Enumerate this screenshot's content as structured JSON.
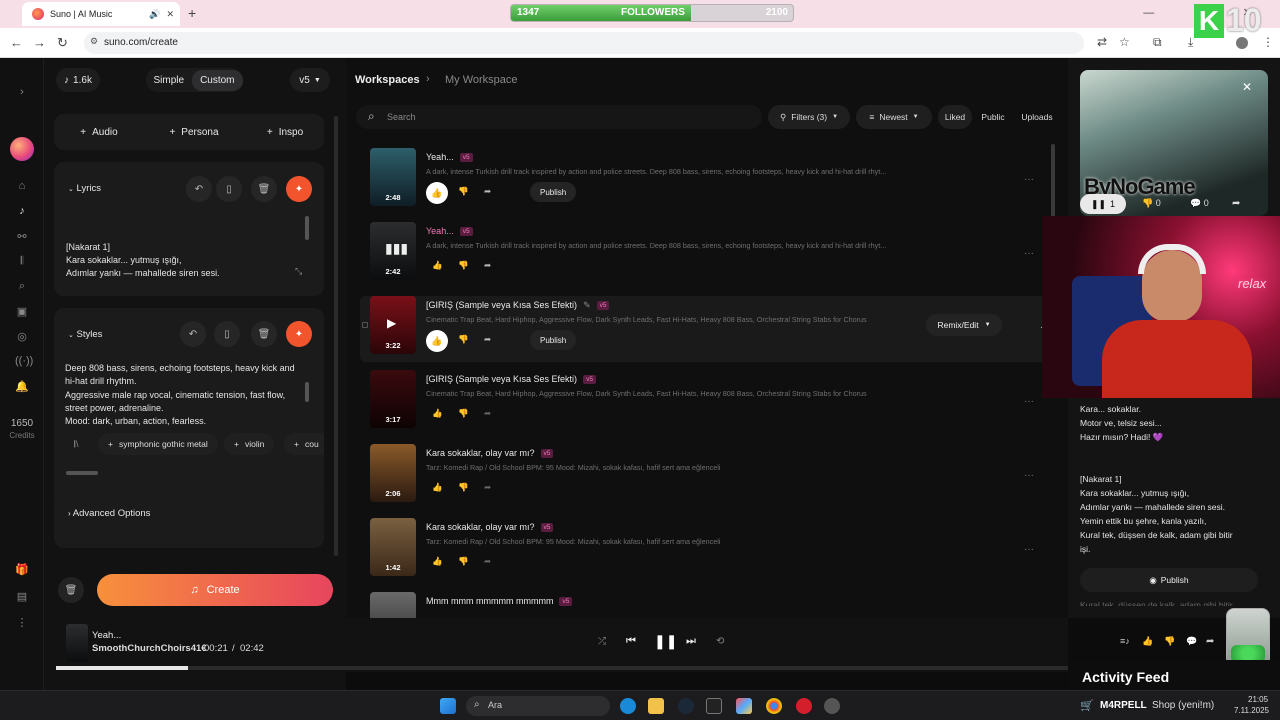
{
  "browser": {
    "tab_title": "Suno | AI Music",
    "new_tab": "+",
    "url": "suno.com/create",
    "window_controls": "—  ▢  ✕"
  },
  "overlay": {
    "followers_label": "FOLLOWERS",
    "followers_current": "1347",
    "followers_goal": "2100",
    "followers_progress": 0.64,
    "k_badge": "K",
    "k_number": "10",
    "watermark": "ByNoGame"
  },
  "sidebar": {
    "credits_value": "1650",
    "credits_label": "Credits"
  },
  "create": {
    "song_count": "1.6k",
    "mode_simple": "Simple",
    "mode_custom": "Custom",
    "model": "v5",
    "add_audio": "Audio",
    "add_persona": "Persona",
    "add_inspo": "Inspo",
    "lyrics_title": "Lyrics",
    "lyrics_lines": [
      "[Nakarat 1]",
      "Kara sokaklar... yutmuş ışığı,",
      "Adımlar yankı — mahallede siren sesi."
    ],
    "styles_title": "Styles",
    "styles_lines": [
      "Deep 808 bass, sirens, echoing footsteps, heavy kick and",
      "hi-hat drill rhythm.",
      "Aggressive male rap vocal, cinematic tension, fast flow,",
      "street power, adrenaline.",
      "Mood: dark, urban, action, fearless."
    ],
    "style_tags": [
      "symphonic gothic metal",
      "violin",
      "cou"
    ],
    "advanced": "Advanced Options",
    "create_button": "Create"
  },
  "workspace": {
    "crumb_root": "Workspaces",
    "crumb_current": "My Workspace",
    "search_placeholder": "Search",
    "filters": "Filters (3)",
    "sort": "Newest",
    "liked": "Liked",
    "public": "Public",
    "uploads": "Uploads",
    "remix": "Remix/Edit",
    "publish": "Publish",
    "v5": "v5",
    "songs": [
      {
        "title": "Yeah...",
        "duration": "2:48",
        "desc": "A dark, intense Turkish drill track inspired by action and police streets. Deep 808 bass, sirens, echoing footsteps, heavy kick and hi-hat drill rhyt...",
        "pink": false,
        "liked": true,
        "publish": true
      },
      {
        "title": "Yeah...",
        "duration": "2:42",
        "desc": "A dark, intense Turkish drill track inspired by action and police streets. Deep 808 bass, sirens, echoing footsteps, heavy kick and hi-hat drill rhyt...",
        "pink": true,
        "liked": false,
        "publish": false
      },
      {
        "title": "[GIRIŞ (Sample veya Kısa Ses Efekti)",
        "duration": "3:22",
        "desc": "Cinematic Trap Beat, Hard Hiphop, Aggressive Flow, Dark Synth Leads, Fast Hi-Hats, Heavy 808 Bass, Orchestral String Stabs for Chorus",
        "pink": false,
        "liked": true,
        "publish": true
      },
      {
        "title": "[GIRIŞ (Sample veya Kısa Ses Efekti)",
        "duration": "3:17",
        "desc": "Cinematic Trap Beat, Hard Hiphop, Aggressive Flow, Dark Synth Leads, Fast Hi-Hats, Heavy 808 Bass, Orchestral String Stabs for Chorus",
        "pink": false,
        "liked": false,
        "publish": false
      },
      {
        "title": "Kara sokaklar, olay var mı?",
        "duration": "2:06",
        "desc": "Tarz: Komedi Rap / Old School BPM: 95 Mood: Mizahi, sokak kafası, hafif sert ama eğlenceli",
        "pink": false,
        "liked": false,
        "publish": false
      },
      {
        "title": "Kara sokaklar, olay var mı?",
        "duration": "1:42",
        "desc": "Tarz: Komedi Rap / Old School BPM: 95 Mood: Mizahi, sokak kafası, hafif sert ama eğlenceli",
        "pink": false,
        "liked": false,
        "publish": false
      },
      {
        "title": "Mmm mmm mmmmm mmmmm",
        "duration": "",
        "desc": "",
        "pink": false,
        "liked": false,
        "publish": false
      }
    ]
  },
  "detail": {
    "likes": "1",
    "dislikes": "0",
    "comments": "0",
    "lyrics": [
      "Kara... sokaklar.",
      "Motor ve, telsiz sesi...",
      "Hazır mısın? Hadi! 💜",
      "",
      "[Nakarat 1]",
      "Kara sokaklar... yutmuş ışığı,",
      "Adımlar yankı — mahallede siren sesi.",
      "Yemin ettik bu şehre, kanla yazılı,",
      "Kural tek, düşsen de kalk, adam gibi bitir",
      "işi."
    ],
    "publish": "Publish",
    "cut_line": "Kural tek, düşsen de kalk, adam gibi bitir"
  },
  "player": {
    "title": "Yeah...",
    "artist": "SmoothChurchChoirs41€",
    "time_current": "00:21",
    "time_sep": "/",
    "time_total": "02:42",
    "progress": 0.13
  },
  "activity_feed": "Activity Feed",
  "taskbar": {
    "search": "Ara",
    "ticker_name": "M4RPELL",
    "ticker_text": "Shop (yeni!m)",
    "time": "21:05",
    "date": "7.11.2025"
  },
  "colors": {
    "accent_orange": "#f2542d",
    "badge_pink": "#f07bb8",
    "followers_green": "#4cb84a"
  }
}
